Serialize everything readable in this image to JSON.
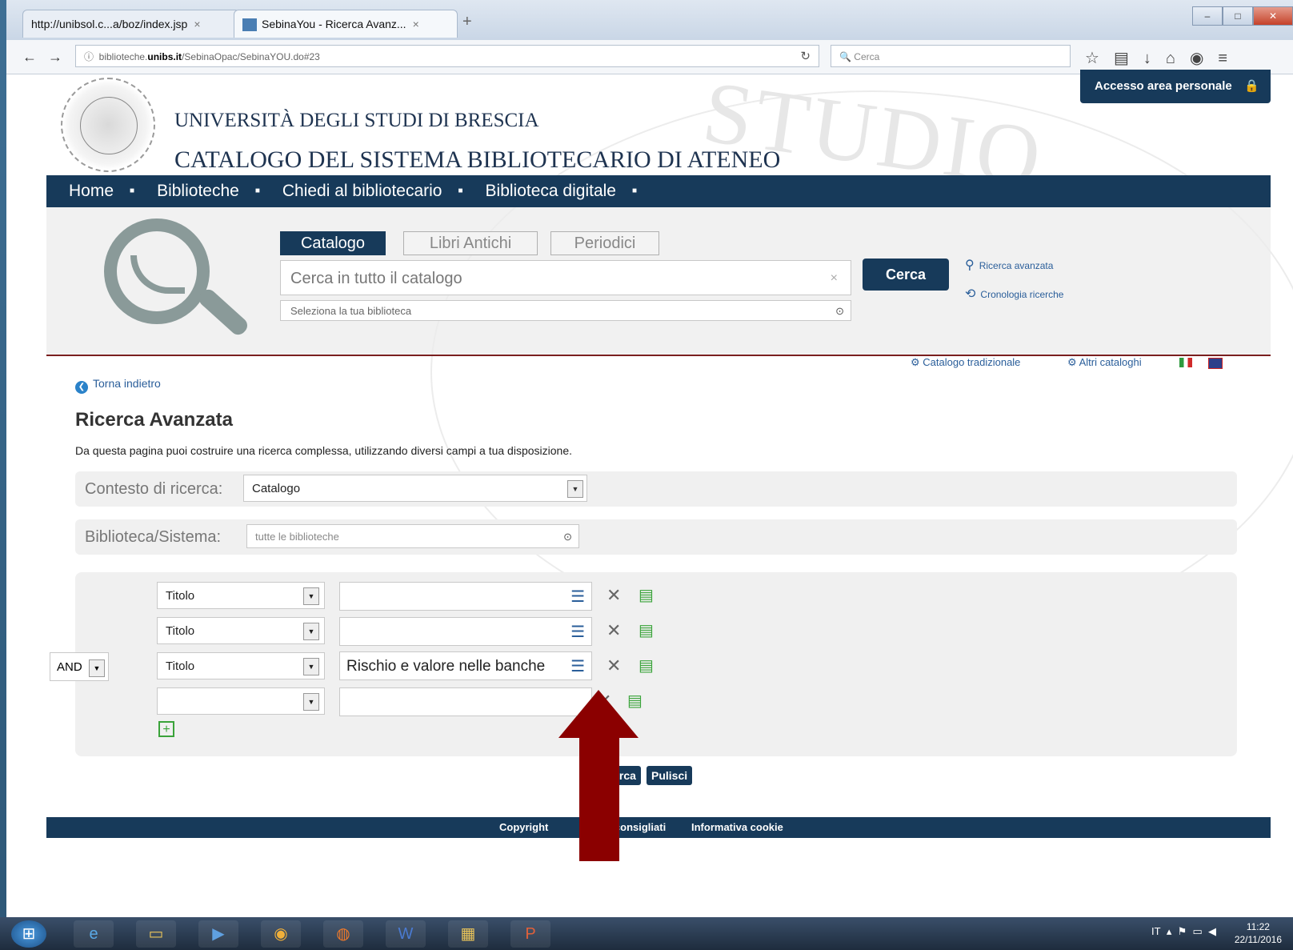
{
  "browser": {
    "tabs": [
      {
        "title": "http://unibsol.c...a/boz/index.jsp"
      },
      {
        "title": "SebinaYou - Ricerca Avanz..."
      }
    ],
    "url_prefix": "biblioteche.",
    "url_domain": "unibs.it",
    "url_path": "/SebinaOpac/SebinaYOU.do#23",
    "search_placeholder": "Cerca"
  },
  "header": {
    "accesso": "Accesso area personale",
    "university": "UNIVERSITÀ DEGLI STUDI DI BRESCIA",
    "catalog": "CATALOGO DEL SISTEMA BIBLIOTECARIO DI ATENEO",
    "watermark": "STUDIO"
  },
  "mainnav": [
    "Home",
    "Biblioteche",
    "Chiedi al bibliotecario",
    "Biblioteca digitale"
  ],
  "search": {
    "tabs": [
      "Catalogo",
      "Libri Antichi",
      "Periodici"
    ],
    "query_placeholder": "Cerca in tutto il catalogo",
    "library_placeholder": "Seleziona la tua biblioteca",
    "button": "Cerca",
    "links": [
      "Ricerca avanzata",
      "Cronologia ricerche"
    ]
  },
  "util": {
    "catalogo_tradizionale": "Catalogo tradizionale",
    "altri_cataloghi": "Altri cataloghi"
  },
  "content": {
    "back": "Torna indietro",
    "title": "Ricerca Avanzata",
    "intro": "Da questa pagina puoi costruire una ricerca complessa, utilizzando diversi campi a tua disposizione.",
    "contesto_label": "Contesto di ricerca:",
    "contesto_value": "Catalogo",
    "biblioteca_label": "Biblioteca/Sistema:",
    "biblioteca_placeholder": "tutte le biblioteche",
    "operator": "AND",
    "rows": [
      {
        "field": "Titolo",
        "term": ""
      },
      {
        "field": "Titolo",
        "term": ""
      },
      {
        "field": "Titolo",
        "term": "Rischio e valore nelle banche"
      },
      {
        "field": "",
        "term": ""
      }
    ],
    "buttons": {
      "cerca": "Cerca",
      "pulisci": "Pulisci"
    }
  },
  "footer": {
    "copyright": "Copyright",
    "consigliati": "er consigliati",
    "cookie": "Informativa cookie"
  },
  "taskbar": {
    "lang": "IT",
    "time": "11:22",
    "date": "22/11/2016"
  },
  "colors": {
    "navy": "#173a5a",
    "arrow": "#8b0000",
    "link": "#2a5e9a"
  }
}
